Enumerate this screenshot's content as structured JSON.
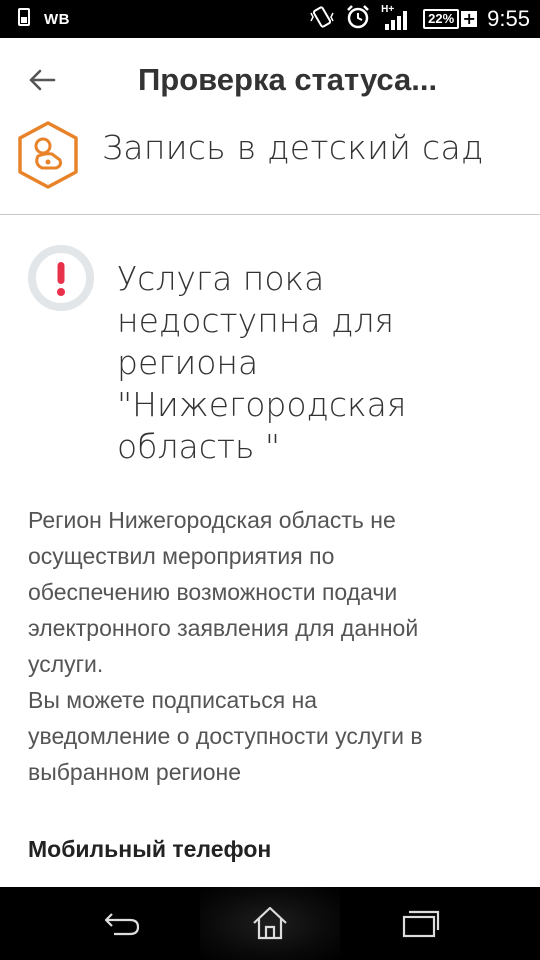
{
  "status_bar": {
    "carrier": "WB",
    "network_type": "H+",
    "battery_level": "22%",
    "battery_charging_symbol": "+",
    "time": "9:55",
    "icons": [
      "sim-icon",
      "vibrate-icon",
      "alarm-icon",
      "signal-icon",
      "battery-icon"
    ]
  },
  "app_bar": {
    "title": "Проверка статуса..."
  },
  "service": {
    "name": "Запись в детский сад",
    "icon": "pacifier-icon",
    "icon_color": "#E8832A"
  },
  "alert": {
    "title_lines": [
      "Услуга пока",
      "недоступна для",
      "региона",
      "\"Нижегородская",
      "область \""
    ],
    "icon": "exclamation-icon",
    "icon_color": "#E8314B"
  },
  "description": {
    "lines": [
      "Регион Нижегородская область не",
      "осуществил мероприятия по",
      "обеспечению возможности подачи",
      "электронного заявления для данной",
      "услуги.",
      "Вы можете подписаться на",
      "уведомление о доступности услуги в",
      "выбранном регионе"
    ]
  },
  "form": {
    "phone_label": "Мобильный телефон"
  },
  "nav_bar": {
    "icons": [
      "back-nav-icon",
      "home-icon",
      "recent-apps-icon"
    ]
  }
}
